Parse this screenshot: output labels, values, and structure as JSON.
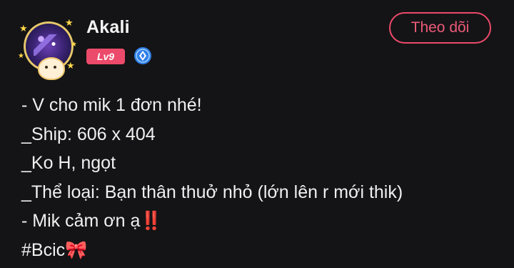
{
  "user": {
    "name": "Akali",
    "level": "Lv9"
  },
  "header": {
    "follow_label": "Theo dõi"
  },
  "post": {
    "lines": [
      "- V cho mik 1 đơn nhé!",
      "_Ship: 606 x 404",
      "_Ko H, ngọt",
      "_Thể loại: Bạn thân thuở nhỏ (lớn lên r mới thik)",
      "- Mik cảm ơn ạ",
      "#Bcic"
    ],
    "line5_emoji": "‼️",
    "line6_emoji": "🎀"
  },
  "colors": {
    "accent": "#ec4a6a",
    "background": "#141416",
    "verify_blue": "#2f7fe8"
  },
  "icons": {
    "verify": "verified-shield-icon",
    "double_exclamation": "double-exclamation-emoji",
    "ribbon": "ribbon-emoji"
  }
}
